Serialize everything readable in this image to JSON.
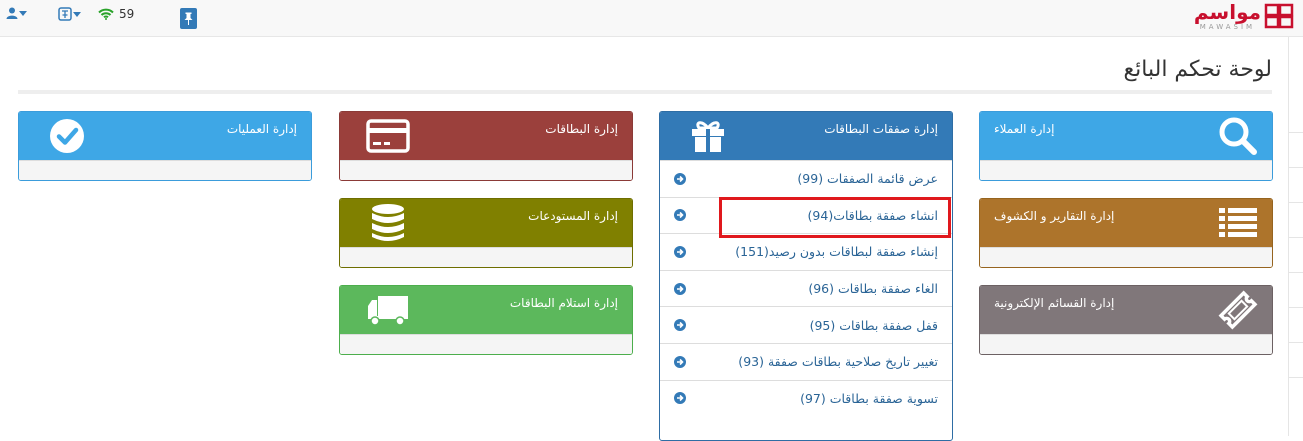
{
  "topbar": {
    "signal_count": "59"
  },
  "logo": {
    "text": "مواسم",
    "subtext": "MAWASIM"
  },
  "page": {
    "title": "لوحة تحكم البائع"
  },
  "panels": {
    "operations": {
      "title": "إدارة العمليات",
      "icon": "check-circle-icon"
    },
    "cards": {
      "title": "إدارة البطاقات",
      "icon": "credit-card-icon"
    },
    "warehouses": {
      "title": "إدارة المستودعات",
      "icon": "database-icon"
    },
    "receiving": {
      "title": "إدارة استلام البطاقات",
      "icon": "truck-icon"
    },
    "deals": {
      "title": "إدارة صفقات البطاقات",
      "icon": "gift-icon"
    },
    "customers": {
      "title": "إدارة العملاء",
      "icon": "search-icon"
    },
    "reports": {
      "title": "إدارة التقارير و الكشوف",
      "icon": "list-icon"
    },
    "coupons": {
      "title": "إدارة القسائم الإلكترونية",
      "icon": "ticket-icon"
    }
  },
  "deals_menu": {
    "items": [
      "عرض قائمة الصفقات (99)",
      "انشاء صفقة بطاقات(94)",
      "إنشاء صفقة لبطاقات بدون رصيد(151)",
      "الغاء صفقة بطاقات (96)",
      "قفل صفقة بطاقات (95)",
      "تغيير تاريخ صلاحية بطاقات صفقة (93)",
      "تسوية صفقة بطاقات (97)"
    ]
  },
  "colors": {
    "blue": "#3ea7e6",
    "red": "#9b403c",
    "olive": "#808000",
    "green": "#5cb85c",
    "navy": "#337ab7",
    "brown": "#ad742b",
    "gray": "#80777a",
    "highlight": "#e0181d"
  }
}
